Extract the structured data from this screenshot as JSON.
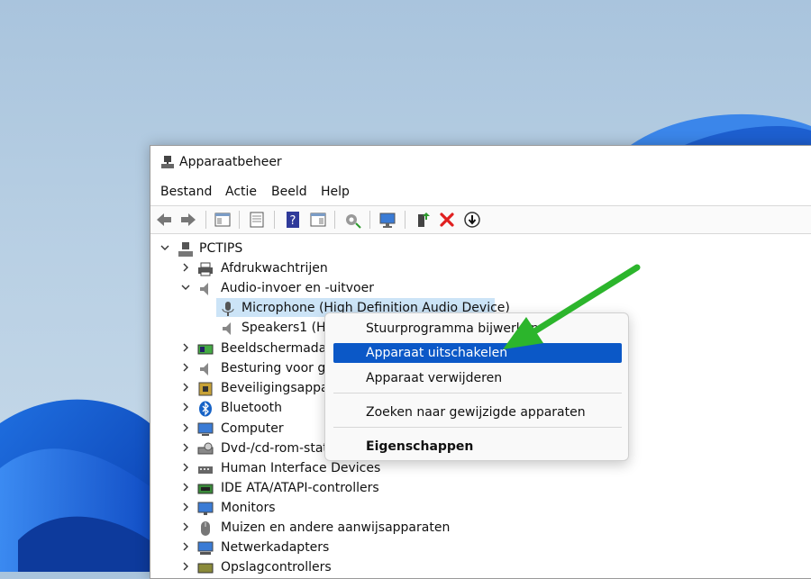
{
  "window": {
    "title": "Apparaatbeheer",
    "menu": [
      "Bestand",
      "Actie",
      "Beeld",
      "Help"
    ]
  },
  "tree": {
    "root": "PCTIPS",
    "items": [
      {
        "label": "Afdrukwachtrijen",
        "icon": "printer-icon"
      },
      {
        "label": "Audio-invoer en -uitvoer",
        "icon": "speaker-icon",
        "expanded": true
      },
      {
        "label": "Microphone (High Definition Audio Device)",
        "icon": "microphone-icon",
        "child": true,
        "selected": true
      },
      {
        "label": "Speakers1 (Hig",
        "icon": "speaker-icon",
        "child": true
      },
      {
        "label": "Beeldschermadap",
        "icon": "display-adapter-icon"
      },
      {
        "label": "Besturing voor ge",
        "icon": "speaker-icon"
      },
      {
        "label": "Beveiligingsappar",
        "icon": "security-device-icon"
      },
      {
        "label": "Bluetooth",
        "icon": "bluetooth-icon"
      },
      {
        "label": "Computer",
        "icon": "computer-icon"
      },
      {
        "label": "Dvd-/cd-rom-stat",
        "icon": "dvd-drive-icon"
      },
      {
        "label": "Human Interface Devices",
        "icon": "hid-icon"
      },
      {
        "label": "IDE ATA/ATAPI-controllers",
        "icon": "ide-controller-icon"
      },
      {
        "label": "Monitors",
        "icon": "monitor-icon"
      },
      {
        "label": "Muizen en andere aanwijsapparaten",
        "icon": "mouse-icon"
      },
      {
        "label": "Netwerkadapters",
        "icon": "network-adapter-icon"
      },
      {
        "label": "Opslagcontrollers",
        "icon": "storage-controller-icon"
      }
    ]
  },
  "context_menu": {
    "update_driver": "Stuurprogramma bijwerken",
    "disable_device": "Apparaat uitschakelen",
    "uninstall_device": "Apparaat verwijderen",
    "scan_hardware": "Zoeken naar gewijzigde apparaten",
    "properties": "Eigenschappen"
  },
  "colors": {
    "highlight": "#0b58c7",
    "selection": "#cce4f7",
    "arrow": "#2cb52c",
    "disable_x": "#e02020"
  }
}
